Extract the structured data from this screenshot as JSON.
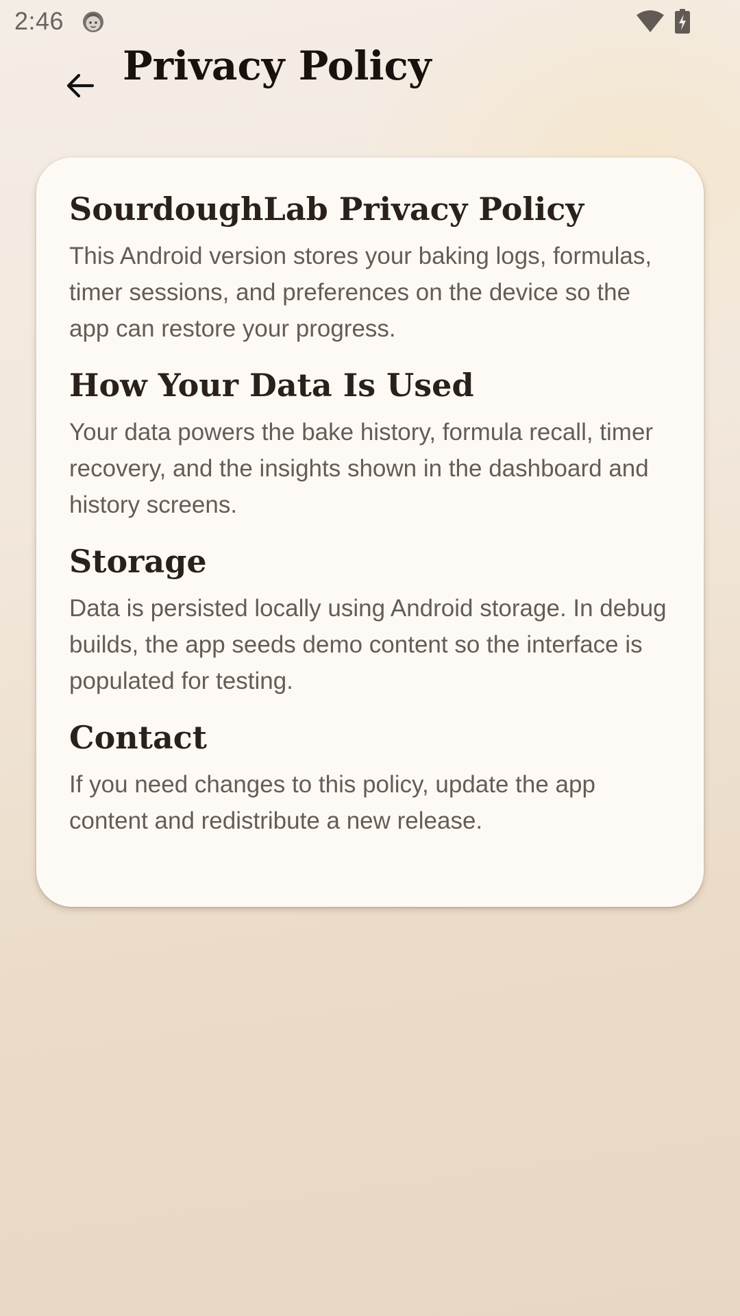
{
  "status_bar": {
    "time": "2:46",
    "icons": [
      "app-notification-icon",
      "wifi-icon",
      "battery-charging-icon"
    ]
  },
  "app_bar": {
    "back_icon": "arrow-left-icon",
    "title": "Privacy Policy"
  },
  "policy": {
    "sections": [
      {
        "heading": "SourdoughLab Privacy Policy",
        "body": "This Android version stores your baking logs, formulas, timer sessions, and preferences on the device so the app can restore your progress."
      },
      {
        "heading": "How Your Data Is Used",
        "body": "Your data powers the bake history, formula recall, timer recovery, and the insights shown in the dashboard and history screens."
      },
      {
        "heading": "Storage",
        "body": "Data is persisted locally using Android storage. In debug builds, the app seeds demo content so the interface is populated for testing."
      },
      {
        "heading": "Contact",
        "body": "If you need changes to this policy, update the app content and redistribute a new release."
      }
    ]
  },
  "colors": {
    "background_top": "#f4ede6",
    "background_bottom": "#e7d7c4",
    "card": "#fdfaf5",
    "heading_text": "#2a211b",
    "body_text": "#655c55",
    "status_text": "#6a625c"
  }
}
